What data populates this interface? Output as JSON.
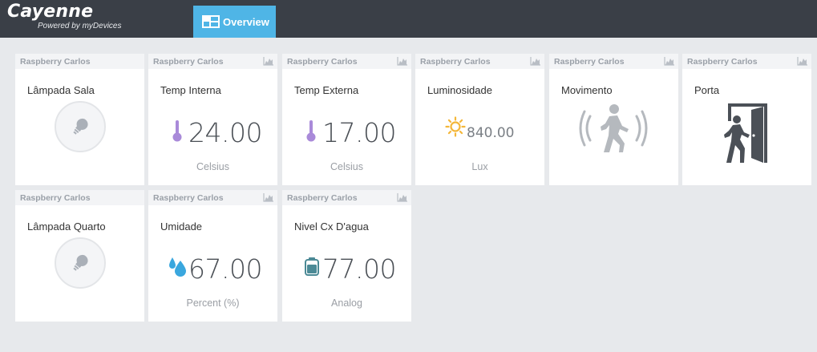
{
  "app": {
    "title": "Cayenne",
    "subtitle": "Powered by myDevices"
  },
  "nav": {
    "overview_label": "Overview"
  },
  "tiles": [
    {
      "device": "Raspberry Carlos",
      "title": "Lâmpada Sala"
    },
    {
      "device": "Raspberry Carlos",
      "title": "Temp Interna",
      "value": "24.00",
      "unit": "Celsius"
    },
    {
      "device": "Raspberry Carlos",
      "title": "Temp Externa",
      "value": "17.00",
      "unit": "Celsius"
    },
    {
      "device": "Raspberry Carlos",
      "title": "Luminosidade",
      "value": "840.00",
      "unit": "Lux"
    },
    {
      "device": "Raspberry Carlos",
      "title": "Movimento"
    },
    {
      "device": "Raspberry Carlos",
      "title": "Porta"
    },
    {
      "device": "Raspberry Carlos",
      "title": "Lâmpada Quarto"
    },
    {
      "device": "Raspberry Carlos",
      "title": "Umidade",
      "value": "67.00",
      "unit": "Percent (%)"
    },
    {
      "device": "Raspberry Carlos",
      "title": "Nivel Cx D'agua",
      "value": "77.00",
      "unit": "Analog"
    }
  ],
  "icons": {
    "overview": "dashboard-icon",
    "chart": "area-chart-icon",
    "bulb": "lightbulb-icon",
    "thermometer": "thermometer-icon",
    "sun": "sun-icon",
    "motion": "motion-person-icon",
    "door": "door-exit-icon",
    "drop": "water-drop-icon",
    "tank": "tank-icon"
  },
  "colors": {
    "topbar": "#3a3f47",
    "accent": "#4fb5e6",
    "thermo": "#a98ad9",
    "sun": "#f4b73a",
    "drop": "#3aa7de",
    "tank": "#4c8a96"
  }
}
